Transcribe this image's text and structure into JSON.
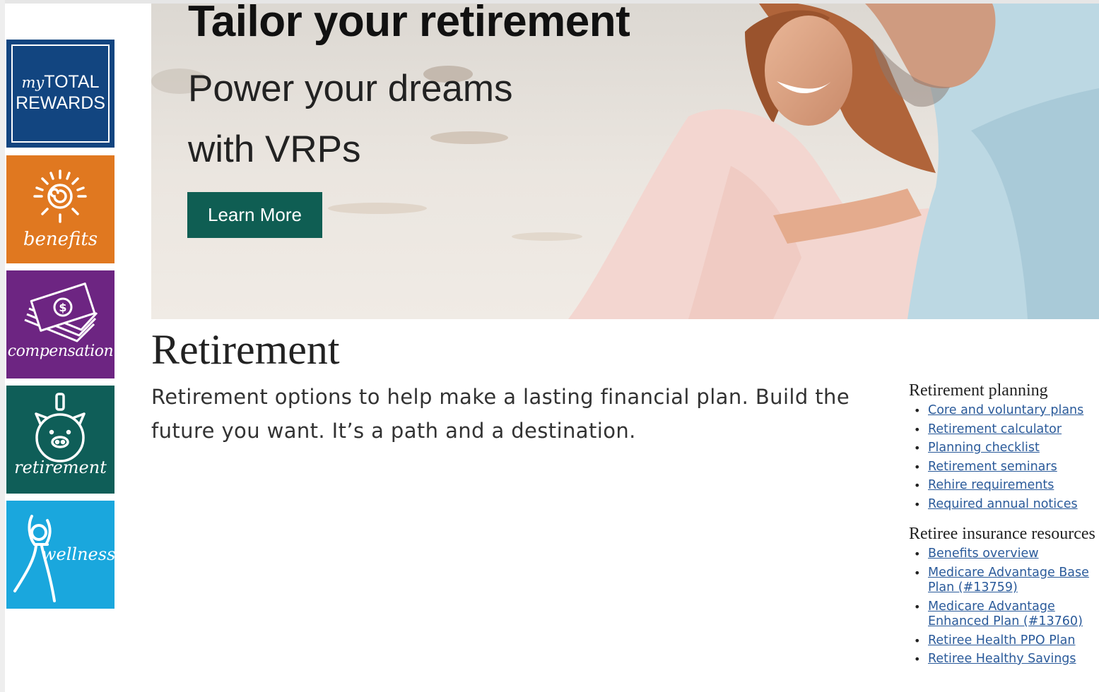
{
  "nav": {
    "tiles": [
      {
        "key": "mtr",
        "line1_prefix": "my",
        "line1": "TOTAL",
        "line2": "REWARDS"
      },
      {
        "key": "benefits",
        "label": "benefits"
      },
      {
        "key": "compensation",
        "label": "compensation"
      },
      {
        "key": "retirement",
        "label": "retirement"
      },
      {
        "key": "wellness",
        "label": "wellness"
      }
    ]
  },
  "hero": {
    "title": "Tailor your retirement",
    "subtitle_line1": "Power your dreams",
    "subtitle_line2": "with VRPs",
    "button_label": "Learn More"
  },
  "main": {
    "title": "Retirement",
    "intro": "Retirement options to help make a lasting financial plan. Build the future you want. It’s a path and a destination."
  },
  "sidebar": {
    "groups": [
      {
        "heading": "Retirement planning",
        "links": [
          "Core and voluntary plans",
          "Retirement calculator",
          "Planning checklist",
          "Retirement seminars",
          "Rehire requirements",
          "Required annual notices"
        ]
      },
      {
        "heading": "Retiree insurance resources",
        "links": [
          "Benefits overview",
          "Medicare Advantage Base Plan (#13759)",
          "Medicare Advantage Enhanced Plan (#13760)",
          "Retiree Health PPO Plan",
          "Retiree Healthy Savings"
        ]
      }
    ]
  },
  "colors": {
    "mytotalrewards": "#124580",
    "benefits": "#e07820",
    "compensation": "#6d2582",
    "retirement": "#0f5e58",
    "wellness": "#1aa7dd",
    "button": "#0f5e53",
    "link": "#2a5a9a"
  }
}
